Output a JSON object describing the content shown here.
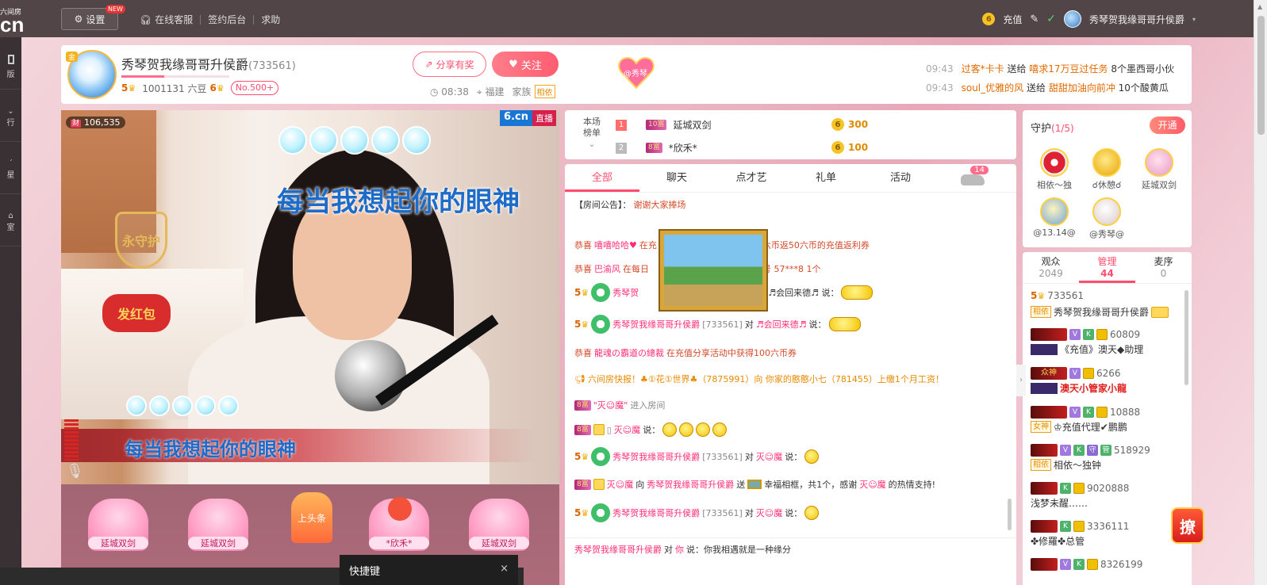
{
  "topbar": {
    "logo_small": "六间房",
    "logo_big": "cn",
    "settings_label": "设置",
    "new_badge": "NEW",
    "links": [
      "在线客服",
      "签约后台",
      "求助"
    ],
    "recharge_label": "充值",
    "username": "秀琴贺我缘哥哥升侯爵"
  },
  "leftrail": {
    "items": [
      "版",
      "行",
      "星",
      "室"
    ]
  },
  "anchor": {
    "badge": "金",
    "name": "秀琴贺我缘哥哥升侯爵",
    "room_id": "(733561)",
    "level_left": "5",
    "beans": "1001131 六豆",
    "level_right": "6",
    "rank_badge": "No.500+",
    "share_label": "分享有奖",
    "follow_label": "关注",
    "time": "08:38",
    "location": "福建",
    "family_label": "家族",
    "family_tag": "相依",
    "heart_badge": "@秀琴"
  },
  "feed": [
    {
      "time": "09:43",
      "user": "过客*卡卡",
      "verb": "送给",
      "target": "嘻求17万豆过任务",
      "gift": "8个墨西哥小伙"
    },
    {
      "time": "09:43",
      "user": "soul_优雅的风",
      "verb": "送给",
      "target": "甜甜加油向前冲",
      "gift": "10个酸黄瓜"
    }
  ],
  "video": {
    "wealth_tag": "财",
    "wealth_count": "106,535",
    "logo": "6.cn",
    "live_label": "直播",
    "lyric_top": "每当我想起你的眼神",
    "lyric_bottom": "每当我想起你的眼神",
    "shield_label": "永守护",
    "redbag_label": "发红包"
  },
  "seats": [
    {
      "label": "延城双剑"
    },
    {
      "label": "延城双剑"
    },
    {
      "label": "上头条"
    },
    {
      "label": "*欣禾*"
    },
    {
      "label": "延城双剑"
    }
  ],
  "bottom_popup": {
    "title": "快捷键",
    "close": "×"
  },
  "rank": {
    "label_line1": "本场",
    "label_line2": "榜单",
    "rows": [
      {
        "num": "1",
        "level": "10富",
        "name": "延城双剑",
        "value": "300"
      },
      {
        "num": "2",
        "level": "8富",
        "name": "*欣禾*",
        "value": "100"
      }
    ]
  },
  "chat": {
    "tabs": [
      "全部",
      "聊天",
      "点才艺",
      "礼单",
      "活动"
    ],
    "car_badge": "14",
    "notice_prefix": "【房间公告】：",
    "notice_text": "谢谢大家捧场",
    "messages": [
      {
        "prefix": "恭喜",
        "user": "嘻嘻哈哈♥",
        "text": "在充",
        "tail": "六币返50六币的充值返利券"
      },
      {
        "prefix": "恭喜",
        "user": "巴渝风",
        "text": "在每日",
        "tail": "号 57***8 1个"
      },
      {
        "user": "秀琴贺",
        "tail": "♬会回来德♬ 说："
      },
      {
        "user": "秀琴贺我缘哥哥升侯爵",
        "rid": "[733561]",
        "verb": "对",
        "target": "♬会回来德♬",
        "tail": "说："
      },
      {
        "prefix": "恭喜",
        "user": "龍魂の霸道の總裁",
        "text": "在充值分享活动中获得100六币券"
      },
      {
        "text": "六间房快报！♣①花①世界♣（7875991）向 你家的憨憨小七（781455）上缴1个月工资！"
      },
      {
        "level": "8富",
        "user": "\"灭☺魔\"",
        "text": "进入房间"
      },
      {
        "level": "8富",
        "user": "灭☺魔",
        "tail": "说："
      },
      {
        "user": "秀琴贺我缘哥哥升侯爵",
        "rid": "[733561]",
        "verb": "对",
        "target": "灭☺魔",
        "tail": "说："
      },
      {
        "level": "8富",
        "user": "灭☺魔",
        "verb": "向",
        "target": "秀琴贺我缘哥哥升侯爵",
        "text": "送",
        "gift": "幸福相框，共1个，感谢",
        "user2": "灭☺魔",
        "tail": "的热情支持!"
      },
      {
        "user": "秀琴贺我缘哥哥升侯爵",
        "rid": "[733561]",
        "verb": "对",
        "target": "灭☺魔",
        "tail": "说："
      }
    ],
    "private": {
      "user": "秀琴贺我缘哥哥升侯爵",
      "verb": "对",
      "target": "你",
      "text": "说：你我相遇就是一种缘分"
    }
  },
  "guard": {
    "title": "守护",
    "count": "(1/5)",
    "open_label": "开通",
    "members": [
      "相依～独",
      "☌休憩☌",
      "延城双剑",
      "@13.14@",
      "@秀琴@"
    ]
  },
  "users": {
    "tabs": [
      {
        "label": "观众",
        "count": "2049"
      },
      {
        "label": "管理",
        "count": "44"
      },
      {
        "label": "麦序",
        "count": "0"
      }
    ],
    "rows": [
      {
        "level": "5",
        "id": "733561",
        "tag": "相依",
        "name": "秀琴贺我缘哥哥升侯爵"
      },
      {
        "id": "60809",
        "name": "《充值》澳天◆助理"
      },
      {
        "tag": "众神",
        "id": "6266",
        "name": "澳天小管家小龍"
      },
      {
        "id": "10888",
        "tag": "女神",
        "name": "♔充值代理✔鹏鹏"
      },
      {
        "tag": "相依",
        "id": "518929",
        "name": "相依～独钟",
        "mgr": "守",
        "mgr2": "管"
      },
      {
        "id": "9020888",
        "name": "浅梦未醒……"
      },
      {
        "id": "3336111",
        "name": "✤修羅✤总管"
      },
      {
        "id": "8326199"
      }
    ]
  },
  "float_btn": "撩"
}
